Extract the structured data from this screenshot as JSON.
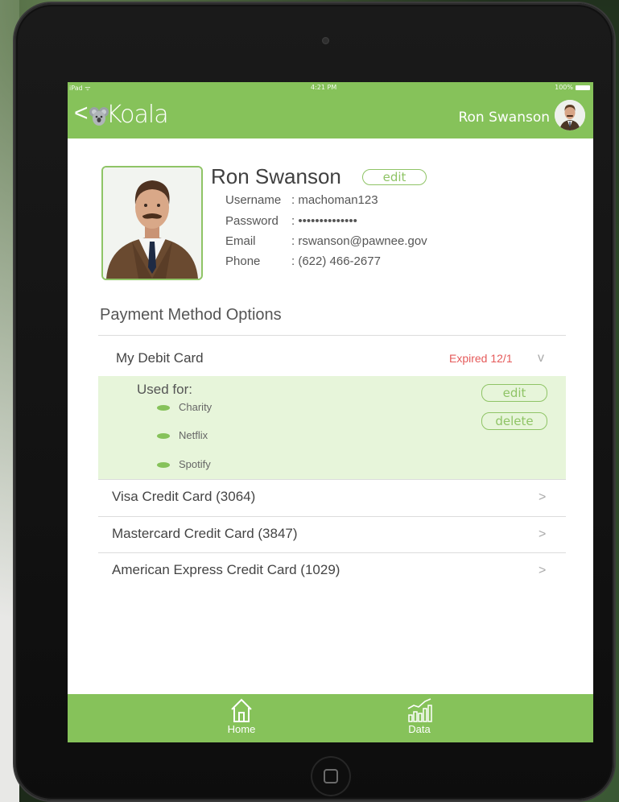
{
  "status_bar": {
    "carrier": "iPad ᯤ",
    "time": "4:21 PM",
    "battery": "100%"
  },
  "nav": {
    "back": "<",
    "app_name": "Koala",
    "user_name": "Ron Swanson"
  },
  "profile": {
    "name": "Ron Swanson",
    "edit_label": "edit",
    "fields": [
      {
        "label": "Username",
        "value": ": machoman123"
      },
      {
        "label": "Password",
        "value": ": ••••••••••••••"
      },
      {
        "label": "Email",
        "value": ": rswanson@pawnee.gov"
      },
      {
        "label": "Phone",
        "value": ": (622) 466-2677"
      }
    ]
  },
  "payment": {
    "title": "Payment Method Options",
    "expanded_card": {
      "label": "My Debit Card",
      "status": "Expired 12/1",
      "chevron": "v",
      "used_for_label": "Used for:",
      "used_for": [
        "Charity",
        "Netflix",
        "Spotify"
      ],
      "edit_label": "edit",
      "delete_label": "delete"
    },
    "cards": [
      {
        "label": "Visa Credit Card (3064)",
        "chevron": ">"
      },
      {
        "label": "Mastercard Credit Card (3847)",
        "chevron": ">"
      },
      {
        "label": "American Express Credit Card (1029)",
        "chevron": ">"
      }
    ]
  },
  "tabs": [
    {
      "label": "Home",
      "icon": "home-icon"
    },
    {
      "label": "Data",
      "icon": "chart-icon"
    }
  ],
  "colors": {
    "brand": "#86c25a",
    "expanded_bg": "#e7f5da",
    "expired": "#e55a5a"
  }
}
